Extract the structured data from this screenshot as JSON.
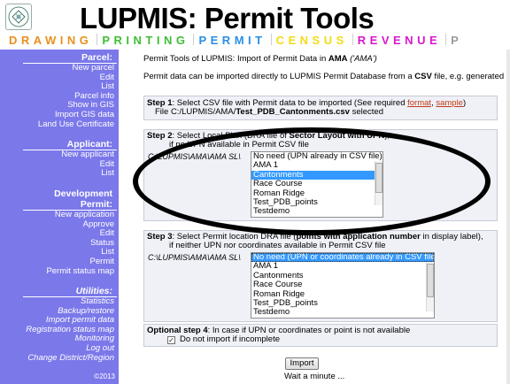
{
  "header": {
    "title": "LUPMIS: Permit Tools",
    "logo_icon": "lupmis-logo-icon",
    "tabs": [
      {
        "label": "DRAWING",
        "color": "#e8911e"
      },
      {
        "label": "PRINTING",
        "color": "#3fbf34"
      },
      {
        "label": "PERMIT",
        "color": "#2a8fe6"
      },
      {
        "label": "CENSUS",
        "color": "#f2dc18"
      },
      {
        "label": "REVENUE",
        "color": "#d619cc"
      },
      {
        "label": "P",
        "color": "#9c9c9c"
      }
    ]
  },
  "sidebar": {
    "bg_color": "#7b78ea",
    "sections": [
      {
        "heading": "Parcel:",
        "italic": false,
        "items": [
          "New parcel",
          "Edit",
          "List",
          "Parcel info",
          "Show in GIS",
          "Import GIS data",
          "Land Use Certificate"
        ]
      },
      {
        "heading": "Applicant:",
        "italic": false,
        "items": [
          "New applicant",
          "Edit",
          "List"
        ]
      },
      {
        "heading": "Development Permit:",
        "italic": false,
        "items": [
          "New application",
          "Approve",
          "Edit",
          "Status",
          "List",
          "Permit",
          "Permit status map"
        ]
      },
      {
        "heading": "Utilities:",
        "italic": true,
        "items": [
          "Statistics",
          "Backup/restore",
          "Import permit data",
          "Registration status map",
          "Monitoring",
          "Log out",
          "Change District/Region"
        ]
      }
    ],
    "copyright": "©2013"
  },
  "main": {
    "title_pre": "Permit Tools of LUPMIS: Import of Permit Data in ",
    "title_ama": "AMA",
    "title_post": " ('AMA')",
    "intro_pre": "Permit data can be imported directly to LUPMIS Permit Database from a ",
    "intro_csv": "CSV",
    "intro_post": " file, e.g. generated in L",
    "step1": {
      "label": "Step 1",
      "text_pre": ": Select CSV file with Permit data to be imported (See required ",
      "link_format": "format",
      "comma": ", ",
      "link_sample": "sample",
      "text_post": ")",
      "file_pre": "File C:/LUPMIS/AMA/",
      "file_name": "Test_PDB_Cantonments.csv",
      "file_post": " selected"
    },
    "step2": {
      "label": "Step 2",
      "text_pre": ": Select Local Plan (DRA file of ",
      "text_bold": "Sector Layout with UPN",
      "text_post": "),",
      "line2": "if no UPN available in Permit CSV file",
      "path": "C:\\LUPMIS\\AMA\\AMA SL\\",
      "options": [
        "No need (UPN already in CSV file)",
        "AMA 1",
        "Cantonments",
        "Race Course",
        "Roman Ridge",
        "Test_PDB_points",
        "Testdemo"
      ],
      "selected": "Cantonments"
    },
    "step3": {
      "label": "Step 3",
      "text_pre": ": Select Permit location DRA file (",
      "text_bold": "points with application number",
      "text_post": " in display label),",
      "line2": "if neither UPN nor coordinates available in Permit CSV file",
      "path": "C:\\LUPMIS\\AMA\\AMA SL\\",
      "options": [
        "No need (UPN or coordinates already in CSV file)",
        "AMA 1",
        "Cantonments",
        "Race Course",
        "Roman Ridge",
        "Test_PDB_points",
        "Testdemo"
      ],
      "selected": "No need (UPN or coordinates already in CSV file)"
    },
    "step4": {
      "label": "Optional step 4",
      "text": ": In case if UPN or coordinates or point is not available",
      "checkbox_label": "Do not import if incomplete",
      "checked": true
    },
    "import_button": "Import",
    "wait_text": "Wait a minute ..."
  }
}
